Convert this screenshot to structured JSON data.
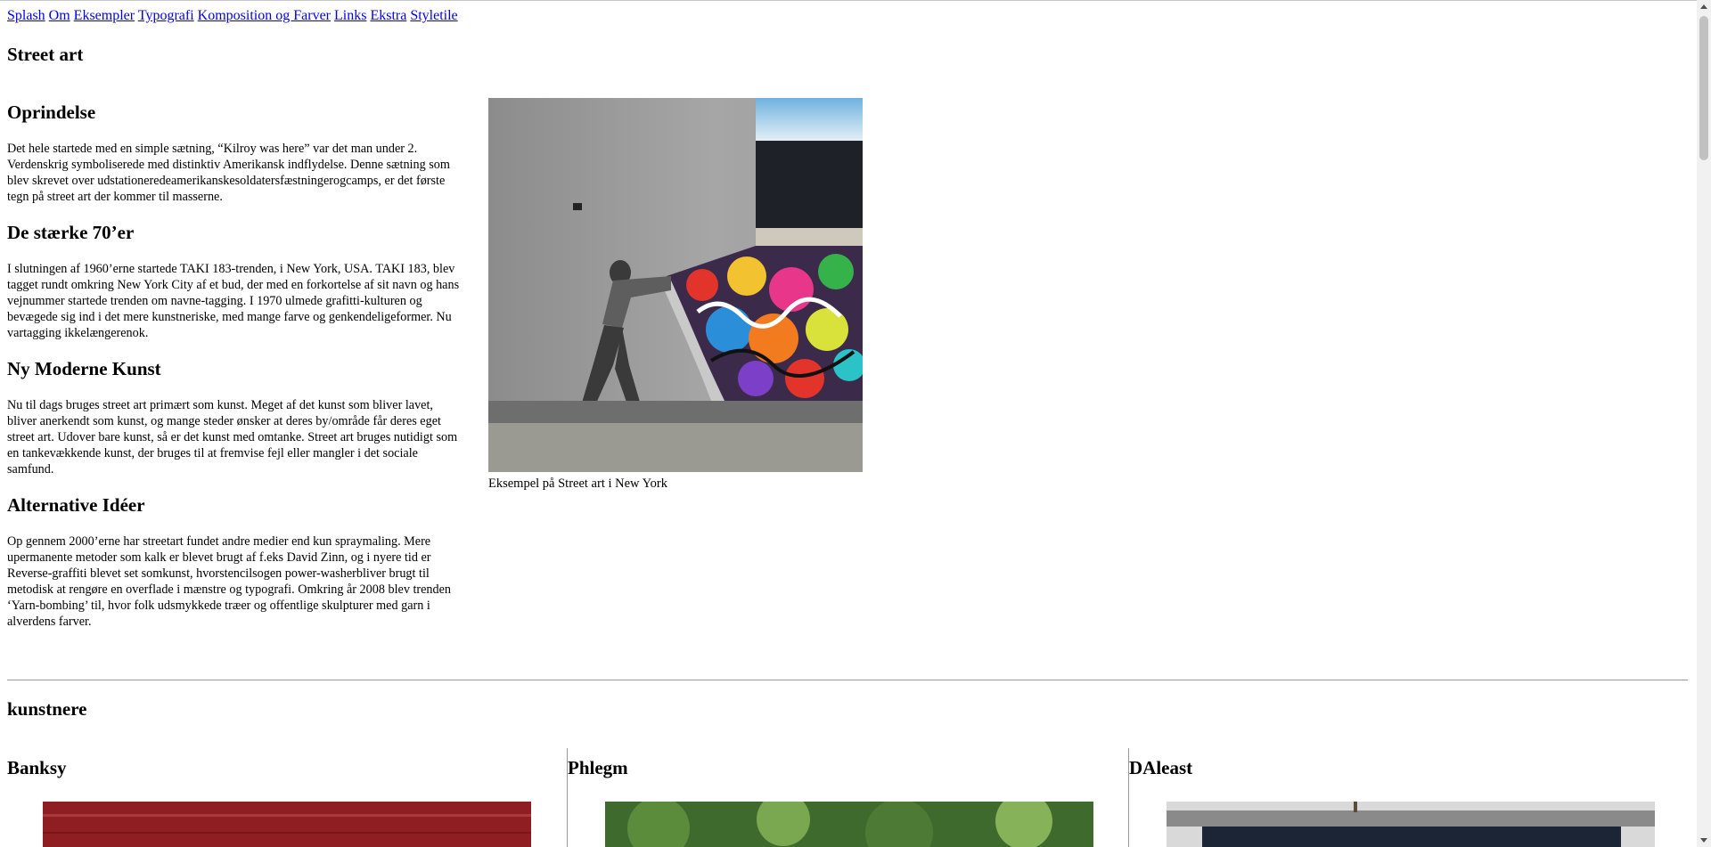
{
  "nav": [
    "Splash",
    "Om",
    "Eksempler",
    "Typografi",
    "Komposition og Farver",
    "Links",
    "Ekstra",
    "Styletile"
  ],
  "title": "Street art",
  "sections": [
    {
      "heading": "Oprindelse",
      "text": "Det hele startede med en simple sætning, “Kilroy was here” var det man under 2. Verdenskrig symboliserede med distinktiv Amerikansk indflydelse. Denne sætning som blev skrevet over udstationeredeamerikanskesoldatersfæstningerogcamps, er det første tegn på street art der kommer til masserne."
    },
    {
      "heading": "De stærke 70’er",
      "text": "I slutningen af 1960’erne startede TAKI 183-trenden, i New York, USA. TAKI 183, blev tagget rundt omkring New York City af et bud, der med en forkortelse af sit navn og hans vejnummer startede trenden om navne-tagging. I 1970 ulmede grafitti-kulturen og bevægede sig ind i det mere kunstneriske, med mange farve og genkendeligeformer. Nu vartagging ikkelængerenok."
    },
    {
      "heading": "Ny Moderne Kunst",
      "text": "Nu til dags bruges street art primært som kunst. Meget af det kunst som bliver lavet, bliver anerkendt som kunst, og mange steder ønsker at deres by/område får deres eget street art. Udover bare kunst, så er det kunst med omtanke. Street art bruges nutidigt som en tankevækkende kunst, der bruges til at fremvise fejl eller mangler i det sociale samfund."
    },
    {
      "heading": "Alternative Idéer",
      "text": "Op gennem 2000’erne har streetart fundet andre medier end kun spraymaling. Mere upermanente metoder som kalk er blevet brugt af f.eks David Zinn, og i nyere tid er Reverse-graffiti blevet set somkunst, hvorstencilsogen power-washerbliver brugt til metodisk at rengøre en overflade i mænstre og typografi. Omkring år 2008 blev trenden ‘Yarn-bombing’ til, hvor folk udsmykkede træer og offentlige skulpturer med garn i alverdens farver."
    }
  ],
  "figure_caption": "Eksempel på Street art i New York",
  "artists_title": "kunstnere",
  "artists": [
    "Banksy",
    "Phlegm",
    "DAleast"
  ]
}
